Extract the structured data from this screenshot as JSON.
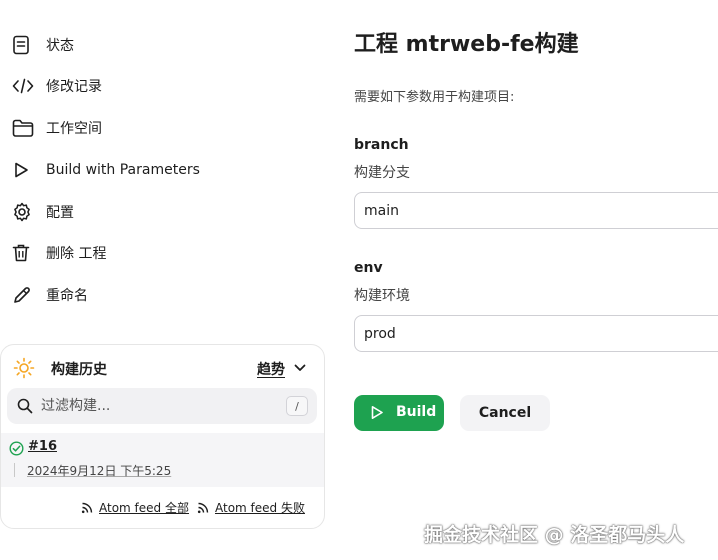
{
  "sidebar": {
    "items": [
      {
        "label": "状态",
        "icon": "document-icon"
      },
      {
        "label": "修改记录",
        "icon": "code-icon"
      },
      {
        "label": "工作空间",
        "icon": "folder-icon"
      },
      {
        "label": "Build with Parameters",
        "icon": "play-icon"
      },
      {
        "label": "配置",
        "icon": "gear-icon"
      },
      {
        "label": "删除 工程",
        "icon": "trash-icon"
      },
      {
        "label": "重命名",
        "icon": "pencil-icon"
      }
    ]
  },
  "build_history": {
    "title": "构建历史",
    "trend_label": "趋势",
    "filter_placeholder": "过滤构建...",
    "filter_shortcut": "/",
    "builds": [
      {
        "number": "#16",
        "date": "2024年9月12日 下午5:25",
        "status": "success"
      }
    ],
    "feeds": [
      {
        "label": "Atom feed 全部"
      },
      {
        "label": "Atom feed 失败"
      }
    ]
  },
  "main": {
    "title": "工程 mtrweb-fe构建",
    "intro": "需要如下参数用于构建项目:",
    "params": [
      {
        "name": "branch",
        "description": "构建分支",
        "value": "main"
      },
      {
        "name": "env",
        "description": "构建环境",
        "value": "prod"
      }
    ],
    "build_button": "Build",
    "cancel_button": "Cancel"
  },
  "watermark": "掘金技术社区 @ 洛圣都马头人",
  "colors": {
    "build_button": "#1ea250",
    "success": "#1ea250",
    "trend_sun": "#f5a623"
  }
}
